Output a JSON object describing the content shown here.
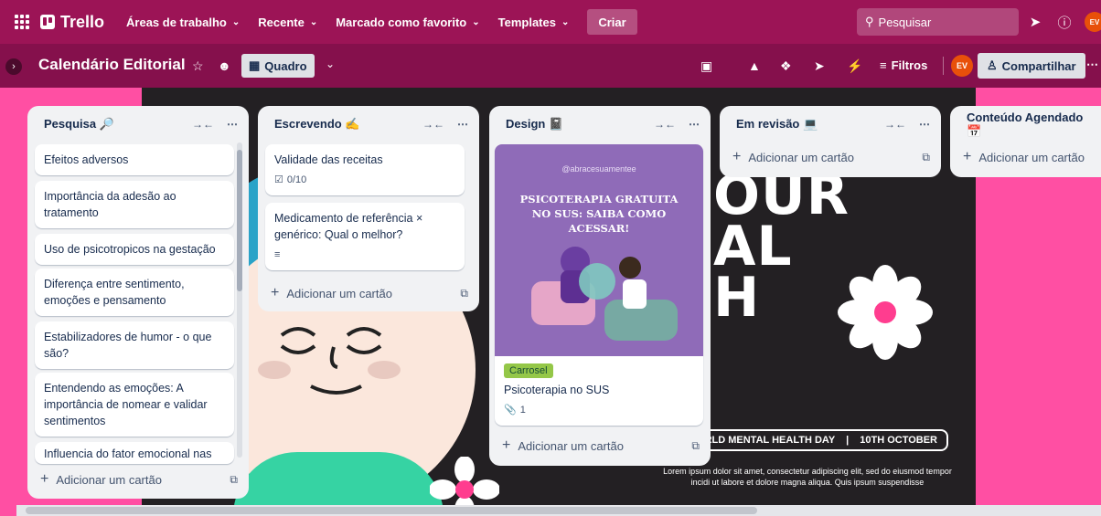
{
  "topnav": {
    "brand": "Trello",
    "menus": [
      {
        "label": "Áreas de trabalho"
      },
      {
        "label": "Recente"
      },
      {
        "label": "Marcado como favorito"
      },
      {
        "label": "Templates"
      }
    ],
    "create_label": "Criar",
    "search_placeholder": "Pesquisar",
    "avatar_initials": "EV"
  },
  "board": {
    "title": "Calendário Editorial",
    "view_label": "Quadro",
    "filters_label": "Filtros",
    "share_label": "Compartilhar",
    "member_initials": "EV"
  },
  "background": {
    "big_text_lines": [
      "OUR",
      "AL",
      "H"
    ],
    "event_text": "RLD MENTAL HEALTH DAY",
    "event_sep": "|",
    "event_date": "10TH OCTOBER",
    "lorem": "Lorem ipsum dolor sit amet, consectetur adipiscing elit, sed do eiusmod tempor incidi ut labore et dolore magna aliqua. Quis ipsum suspendisse"
  },
  "lists": [
    {
      "title": "Pesquisa 🔎",
      "cards": [
        "Efeitos adversos",
        "Importância da adesão ao tratamento",
        "Uso de psicotropicos na gestação",
        "Diferença entre sentimento, emoções e pensamento",
        "Estabilizadores de humor - o que são?",
        "Entendendo as emoções: A importância de nomear e validar sentimentos",
        "Influencia do fator emocional nas"
      ],
      "add_label": "Adicionar um cartão"
    },
    {
      "title": "Escrevendo ✍",
      "cards": [
        {
          "title": "Validade das receitas",
          "checklist": "0/10"
        },
        {
          "title": "Medicamento de referência × genérico: Qual o melhor?"
        }
      ],
      "add_label": "Adicionar um cartão"
    },
    {
      "title": "Design 📓",
      "cards": [
        {
          "cover_handle": "@abracesuamentee",
          "cover_headline": [
            "PSICOTERAPIA GRATUITA",
            "NO SUS: SAIBA COMO",
            "ACESSAR!"
          ],
          "label": "Carrosel",
          "title": "Psicoterapia no SUS",
          "attachments": "1"
        }
      ],
      "add_label": "Adicionar um cartão"
    },
    {
      "title": "Em revisão 💻",
      "add_label": "Adicionar um cartão"
    },
    {
      "title": "Conteúdo Agendado 📅",
      "add_label": "Adicionar um cartão"
    }
  ],
  "colors": {
    "nav_bg": "#9c1456",
    "board_bg": "#ff4fa3",
    "label_green": "#94c748"
  }
}
